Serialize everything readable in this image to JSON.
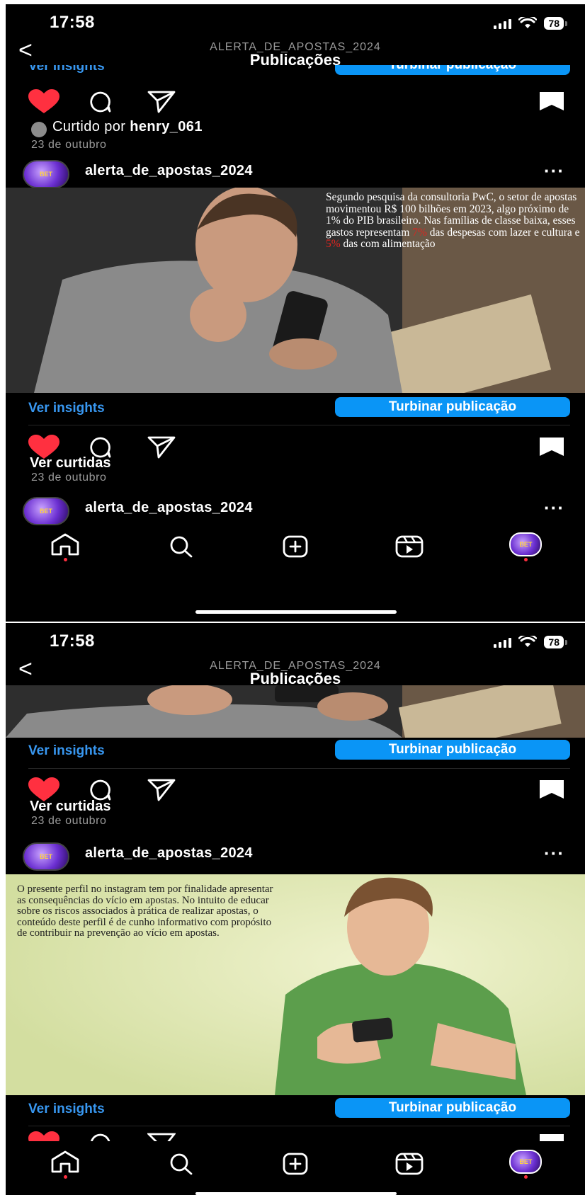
{
  "status_bar": {
    "time": "17:58",
    "battery": "78"
  },
  "header": {
    "account": "ALERTA_DE_APOSTAS_2024",
    "title": "Publicações",
    "back": "<"
  },
  "actions": {
    "insights": "Ver insights",
    "boost": "Turbinar publicação",
    "ver_curtidas": "Ver curtidas"
  },
  "screen1": {
    "top_insights": "Ver insights",
    "top_boost": "Turbinar publicação",
    "liked_by_prefix": "Curtido por ",
    "liked_by_user": "henry_061",
    "date1": "23 de outubro",
    "post1_username": "alerta_de_apostas_2024",
    "post1_overlay_1": "Segundo pesquisa da consultoria PwC, o setor de apostas movimentou R$ 100 bilhões em 2023, algo próximo de 1% do PIB brasileiro. Nas famílias de classe baixa, esses gastos representam ",
    "post1_overlay_red1": "7%",
    "post1_overlay_2": " das despesas com lazer e cultura e ",
    "post1_overlay_red2": "5%",
    "post1_overlay_3": " das com alimentação",
    "date2": "23 de outubro",
    "post2_username": "alerta_de_apostas_2024"
  },
  "screen2": {
    "date": "23 de outubro",
    "post_username": "alerta_de_apostas_2024",
    "post_overlay": "O presente perfil no instagram tem por finalidade apresentar as consequências do vício em apostas. No intuito de educar sobre os riscos associados à prática de realizar apostas, o conteúdo deste perfil é de cunho informativo com propósito de contribuir na prevenção ao vício em apostas."
  },
  "icons": {
    "like": "heart-icon",
    "comment": "comment-icon",
    "share": "send-icon",
    "save": "bookmark-icon",
    "more": "more-icon",
    "home": "home-icon",
    "search": "search-icon",
    "create": "create-icon",
    "reels": "reels-icon",
    "profile": "profile-avatar"
  },
  "colors": {
    "accent": "#0a95f6",
    "link": "#3897f0",
    "like": "#ff3040",
    "background": "#000000"
  }
}
